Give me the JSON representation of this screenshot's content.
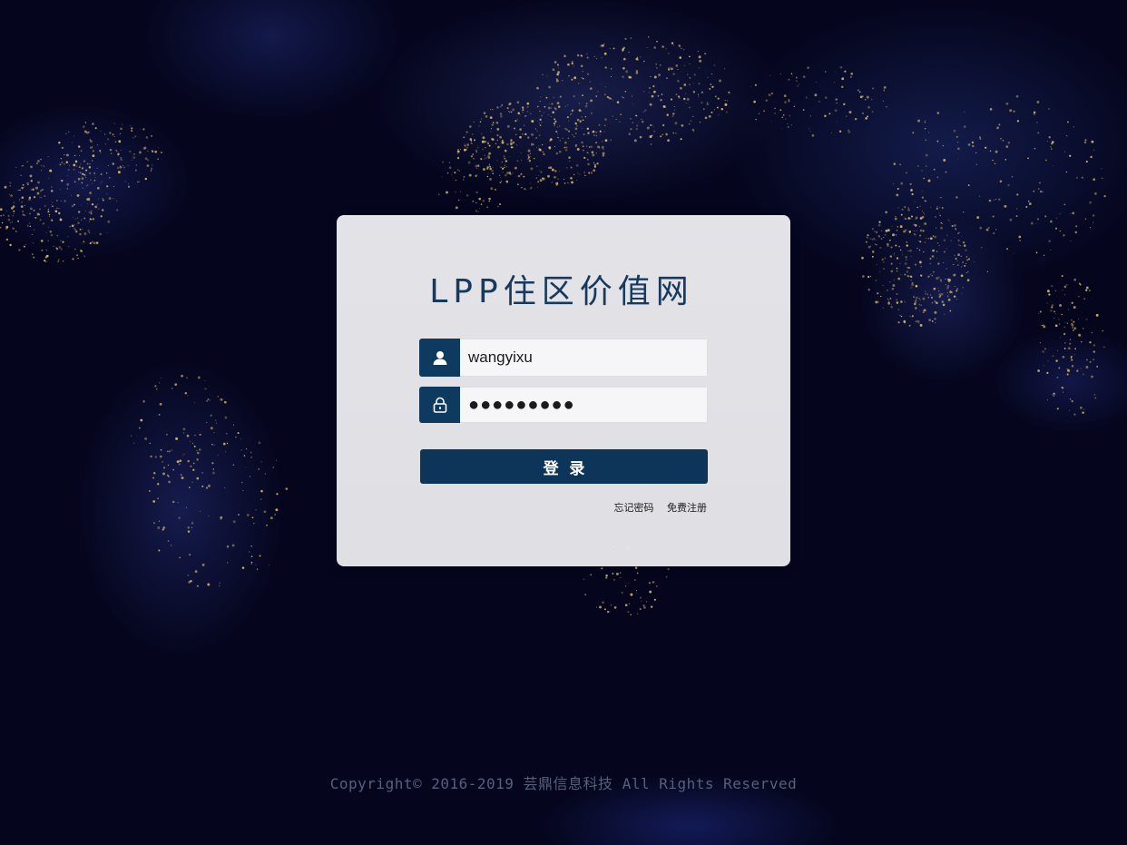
{
  "app": {
    "title": "LPP住区价值网"
  },
  "login_form": {
    "username_value": "wangyixu",
    "password_value": "●●●●●●●●●",
    "login_button_label": "登  录",
    "forgot_password_link": "忘记密码",
    "register_link": "免费注册"
  },
  "icons": {
    "username": "user-icon",
    "password": "lock-icon"
  },
  "footer": {
    "copyright": "Copyright© 2016-2019 芸鼎信息科技 All Rights Reserved"
  },
  "colors": {
    "brand_navy": "#0e3a5f",
    "title_color": "#163a5f",
    "background": "#05061e",
    "footer_text": "#56607a"
  }
}
